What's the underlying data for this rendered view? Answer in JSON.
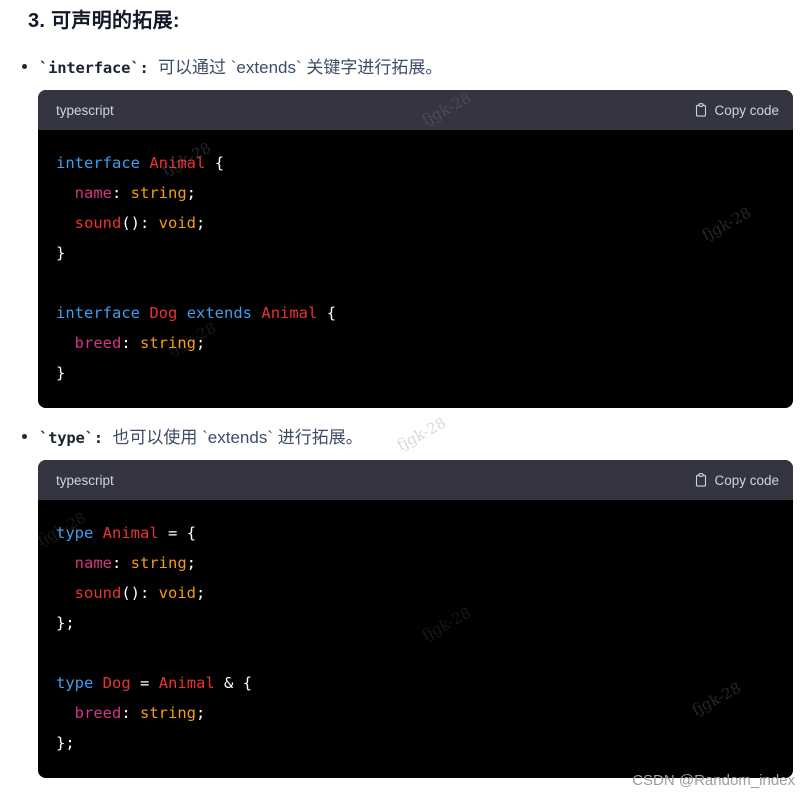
{
  "heading": "3. 可声明的拓展:",
  "bullets": [
    {
      "code_label": "`interface`:",
      "description": "可以通过 `extends` 关键字进行拓展。"
    },
    {
      "code_label": "`type`:",
      "description": "也可以使用 `extends` 进行拓展。"
    }
  ],
  "code_blocks": [
    {
      "language": "typescript",
      "copy_label": "Copy code",
      "copy_icon": "clipboard-icon",
      "lines": [
        [
          {
            "t": "interface",
            "c": "kw"
          },
          {
            "t": " ",
            "c": "plain"
          },
          {
            "t": "Animal",
            "c": "type"
          },
          {
            "t": " ",
            "c": "plain"
          },
          {
            "t": "{",
            "c": "punc"
          }
        ],
        [
          {
            "t": "  ",
            "c": "plain"
          },
          {
            "t": "name",
            "c": "prop"
          },
          {
            "t": ": ",
            "c": "punc"
          },
          {
            "t": "string",
            "c": "prim"
          },
          {
            "t": ";",
            "c": "punc"
          }
        ],
        [
          {
            "t": "  ",
            "c": "plain"
          },
          {
            "t": "sound",
            "c": "fn"
          },
          {
            "t": "(): ",
            "c": "punc"
          },
          {
            "t": "void",
            "c": "prim"
          },
          {
            "t": ";",
            "c": "punc"
          }
        ],
        [
          {
            "t": "}",
            "c": "punc"
          }
        ],
        [
          {
            "t": "",
            "c": "plain"
          }
        ],
        [
          {
            "t": "interface",
            "c": "kw"
          },
          {
            "t": " ",
            "c": "plain"
          },
          {
            "t": "Dog",
            "c": "type"
          },
          {
            "t": " ",
            "c": "plain"
          },
          {
            "t": "extends",
            "c": "kw"
          },
          {
            "t": " ",
            "c": "plain"
          },
          {
            "t": "Animal",
            "c": "type"
          },
          {
            "t": " ",
            "c": "plain"
          },
          {
            "t": "{",
            "c": "punc"
          }
        ],
        [
          {
            "t": "  ",
            "c": "plain"
          },
          {
            "t": "breed",
            "c": "prop"
          },
          {
            "t": ": ",
            "c": "punc"
          },
          {
            "t": "string",
            "c": "prim"
          },
          {
            "t": ";",
            "c": "punc"
          }
        ],
        [
          {
            "t": "}",
            "c": "punc"
          }
        ]
      ]
    },
    {
      "language": "typescript",
      "copy_label": "Copy code",
      "copy_icon": "clipboard-icon",
      "lines": [
        [
          {
            "t": "type",
            "c": "kw"
          },
          {
            "t": " ",
            "c": "plain"
          },
          {
            "t": "Animal",
            "c": "type"
          },
          {
            "t": " ",
            "c": "plain"
          },
          {
            "t": "=",
            "c": "op"
          },
          {
            "t": " ",
            "c": "plain"
          },
          {
            "t": "{",
            "c": "punc"
          }
        ],
        [
          {
            "t": "  ",
            "c": "plain"
          },
          {
            "t": "name",
            "c": "prop"
          },
          {
            "t": ": ",
            "c": "punc"
          },
          {
            "t": "string",
            "c": "prim"
          },
          {
            "t": ";",
            "c": "punc"
          }
        ],
        [
          {
            "t": "  ",
            "c": "plain"
          },
          {
            "t": "sound",
            "c": "fn"
          },
          {
            "t": "(): ",
            "c": "punc"
          },
          {
            "t": "void",
            "c": "prim"
          },
          {
            "t": ";",
            "c": "punc"
          }
        ],
        [
          {
            "t": "};",
            "c": "punc"
          }
        ],
        [
          {
            "t": "",
            "c": "plain"
          }
        ],
        [
          {
            "t": "type",
            "c": "kw"
          },
          {
            "t": " ",
            "c": "plain"
          },
          {
            "t": "Dog",
            "c": "type"
          },
          {
            "t": " ",
            "c": "plain"
          },
          {
            "t": "=",
            "c": "op"
          },
          {
            "t": " ",
            "c": "plain"
          },
          {
            "t": "Animal",
            "c": "type"
          },
          {
            "t": " ",
            "c": "plain"
          },
          {
            "t": "&",
            "c": "op"
          },
          {
            "t": " ",
            "c": "plain"
          },
          {
            "t": "{",
            "c": "punc"
          }
        ],
        [
          {
            "t": "  ",
            "c": "plain"
          },
          {
            "t": "breed",
            "c": "prop"
          },
          {
            "t": ": ",
            "c": "punc"
          },
          {
            "t": "string",
            "c": "prim"
          },
          {
            "t": ";",
            "c": "punc"
          }
        ],
        [
          {
            "t": "};",
            "c": "punc"
          }
        ]
      ]
    }
  ],
  "watermarks": {
    "tiled_text": "fjgk-28",
    "footer_credit": "CSDN @Random_index"
  },
  "colors": {
    "code_header_bg": "#343541",
    "code_body_bg": "#000000",
    "keyword": "#3b9ff0",
    "type": "#e8332e",
    "property": "#d63384",
    "primitive": "#f59e0b",
    "punctuation": "#ffffff",
    "body_text": "#3a4a63",
    "heading_text": "#111827"
  }
}
